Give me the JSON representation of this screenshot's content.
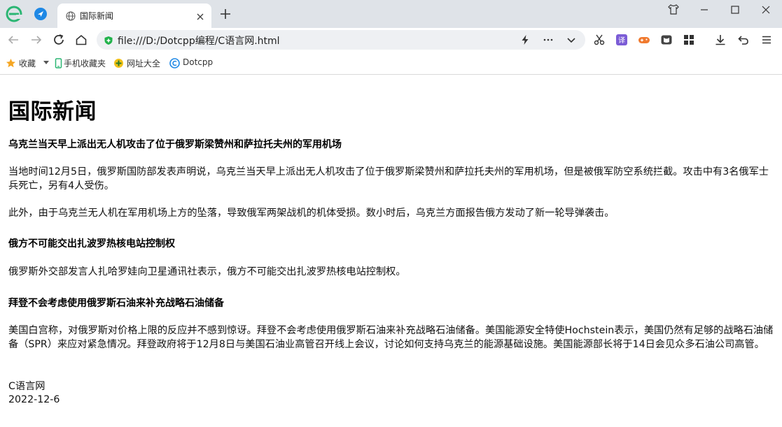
{
  "browser": {
    "tab": {
      "title": "国际新闻"
    },
    "address_bar": {
      "url": "file:///D:/Dotcpp编程/C语言网.html"
    },
    "bookmarks": [
      {
        "label": "收藏",
        "icon": "star-icon"
      },
      {
        "label": "手机收藏夹",
        "icon": "phone-icon"
      },
      {
        "label": "网址大全",
        "icon": "web-directory-icon"
      },
      {
        "label": "Dotcpp",
        "icon": "dotcpp-icon"
      }
    ]
  },
  "page": {
    "title": "国际新闻",
    "sections": [
      {
        "heading": "乌克兰当天早上派出无人机攻击了位于俄罗斯梁赞州和萨拉托夫州的军用机场",
        "paragraphs": [
          "当地时间12月5日，俄罗斯国防部发表声明说，乌克兰当天早上派出无人机攻击了位于俄罗斯梁赞州和萨拉托夫州的军用机场，但是被俄军防空系统拦截。攻击中有3名俄军士兵死亡，另有4人受伤。",
          "此外，由于乌克兰无人机在军用机场上方的坠落，导致俄军两架战机的机体受损。数小时后，乌克兰方面报告俄方发动了新一轮导弹袭击。"
        ]
      },
      {
        "heading": "俄方不可能交出扎波罗热核电站控制权",
        "paragraphs": [
          "俄罗斯外交部发言人扎哈罗娃向卫星通讯社表示，俄方不可能交出扎波罗热核电站控制权。"
        ]
      },
      {
        "heading": "拜登不会考虑使用俄罗斯石油来补充战略石油储备",
        "paragraphs": [
          "美国白宫称，对俄罗斯对价格上限的反应并不感到惊讶。拜登不会考虑使用俄罗斯石油来补充战略石油储备。美国能源安全特使Hochstein表示，美国仍然有足够的战略石油储备（SPR）来应对紧急情况。拜登政府将于12月8日与美国石油业高管召开线上会议，讨论如何支持乌克兰的能源基础设施。美国能源部长将于14日会见众多石油公司高管。"
        ]
      }
    ],
    "footer": {
      "site": "C语言网",
      "date": "2022-12-6"
    }
  },
  "colors": {
    "titlebar_bg": "#dfe3e8",
    "addressbar_bg": "#eef0f3",
    "logo_green": "#2bb673",
    "accent_blue": "#1e88e5",
    "secure_green": "#21b24b"
  }
}
